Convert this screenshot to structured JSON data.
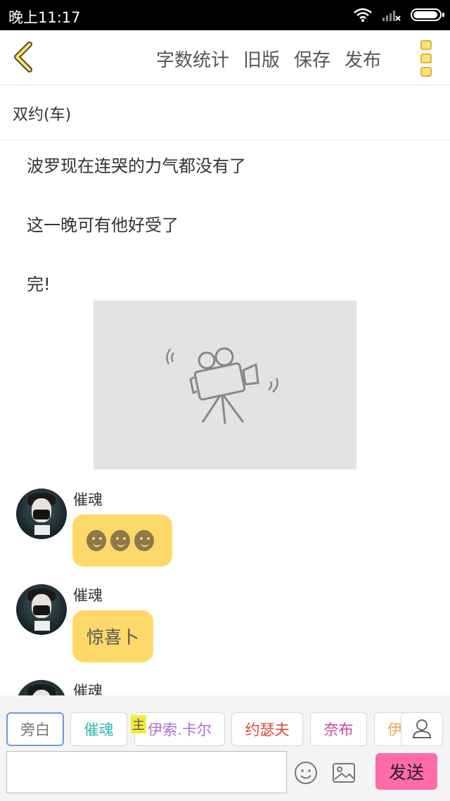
{
  "status_bar": {
    "time": "晚上11:17"
  },
  "toolbar": {
    "actions": [
      "字数统计",
      "旧版",
      "保存",
      "发布"
    ]
  },
  "title": "双约(车)",
  "story": {
    "paragraphs": [
      "波罗现在连哭的力气都没有了",
      "这一晚可有他好受了",
      "完!"
    ]
  },
  "messages": [
    {
      "sender": "催魂",
      "type": "emoji",
      "emoji_count": 3
    },
    {
      "sender": "催魂",
      "text": "惊喜卜"
    },
    {
      "sender": "催魂"
    }
  ],
  "characters": {
    "items": [
      {
        "label": "旁白",
        "color": "#777777",
        "selected": true
      },
      {
        "label": "催魂",
        "color": "#2bb8b0"
      },
      {
        "label": "伊索.卡尔",
        "color": "#b06fd0"
      },
      {
        "label": "约瑟夫",
        "color": "#d64a3a"
      },
      {
        "label": "奈布",
        "color": "#c9479a"
      },
      {
        "label": "伊",
        "color": "#f2a25a"
      }
    ],
    "lead_badge": "主"
  },
  "composer": {
    "send_label": "发送"
  }
}
